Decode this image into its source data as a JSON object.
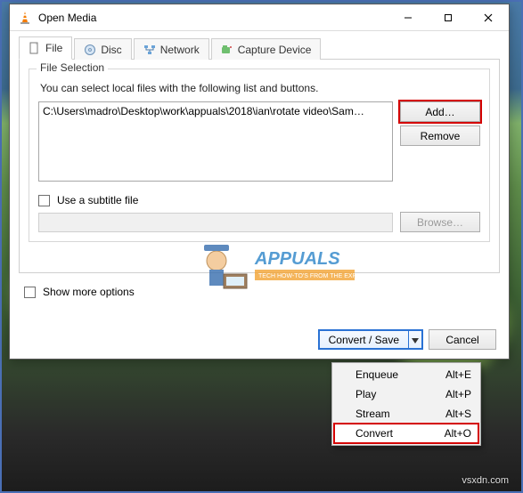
{
  "window": {
    "title": "Open Media"
  },
  "tabs": {
    "file": "File",
    "disc": "Disc",
    "network": "Network",
    "capture": "Capture Device"
  },
  "fileSelection": {
    "legend": "File Selection",
    "desc": "You can select local files with the following list and buttons.",
    "item0": "C:\\Users\\madro\\Desktop\\work\\appuals\\2018\\ian\\rotate video\\Sam…",
    "add": "Add…",
    "remove": "Remove"
  },
  "subtitle": {
    "label": "Use a subtitle file",
    "browse": "Browse…"
  },
  "more": {
    "label": "Show more options"
  },
  "convert": {
    "label": "Convert / Save"
  },
  "cancel": {
    "label": "Cancel"
  },
  "menu": {
    "enqueue": {
      "label": "Enqueue",
      "key": "Alt+E"
    },
    "play": {
      "label": "Play",
      "key": "Alt+P"
    },
    "stream": {
      "label": "Stream",
      "key": "Alt+S"
    },
    "convert": {
      "label": "Convert",
      "key": "Alt+O"
    }
  },
  "watermark": "vsxdn.com",
  "brand": {
    "name": "APPUALS",
    "tag": "TECH HOW-TO'S FROM THE EXPERTS"
  }
}
